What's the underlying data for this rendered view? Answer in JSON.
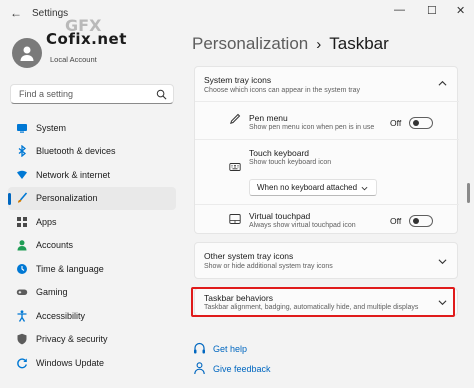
{
  "app": {
    "title": "Settings",
    "back_glyph": "←",
    "min_glyph": "—",
    "max_glyph": "☐",
    "close_glyph": "✕"
  },
  "profile": {
    "brand": "Cofix.net",
    "brand_watermark": "GFX",
    "account_type": "Local Account"
  },
  "search": {
    "placeholder": "Find a setting"
  },
  "nav": {
    "items": [
      {
        "label": "System",
        "icon": "system-icon",
        "color": "#0078d4"
      },
      {
        "label": "Bluetooth & devices",
        "icon": "bluetooth-icon",
        "color": "#0078d4"
      },
      {
        "label": "Network & internet",
        "icon": "network-icon",
        "color": "#0078d4"
      },
      {
        "label": "Personalization",
        "icon": "brush-icon",
        "color": "#d07a00",
        "active": true
      },
      {
        "label": "Apps",
        "icon": "apps-icon",
        "color": "#4a4a4a"
      },
      {
        "label": "Accounts",
        "icon": "accounts-icon",
        "color": "#1f9d55"
      },
      {
        "label": "Time & language",
        "icon": "time-language-icon",
        "color": "#0078d4"
      },
      {
        "label": "Gaming",
        "icon": "gaming-icon",
        "color": "#5c5c5c"
      },
      {
        "label": "Accessibility",
        "icon": "accessibility-icon",
        "color": "#0078d4"
      },
      {
        "label": "Privacy & security",
        "icon": "shield-icon",
        "color": "#5c5c5c"
      },
      {
        "label": "Windows Update",
        "icon": "update-icon",
        "color": "#0078d4"
      }
    ]
  },
  "breadcrumb": {
    "parent": "Personalization",
    "separator": "›",
    "current": "Taskbar"
  },
  "tray": {
    "title": "System tray icons",
    "subtitle": "Choose which icons can appear in the system tray",
    "pen": {
      "title": "Pen menu",
      "subtitle": "Show pen menu icon when pen is in use",
      "state": "Off"
    },
    "keyboard": {
      "title": "Touch keyboard",
      "subtitle": "Show touch keyboard icon",
      "selected": "When no keyboard attached"
    },
    "touchpad": {
      "title": "Virtual touchpad",
      "subtitle": "Always show virtual touchpad icon",
      "state": "Off"
    }
  },
  "other_tray": {
    "title": "Other system tray icons",
    "subtitle": "Show or hide additional system tray icons"
  },
  "behaviors": {
    "title": "Taskbar behaviors",
    "subtitle": "Taskbar alignment, badging, automatically hide, and multiple displays"
  },
  "links": {
    "help": "Get help",
    "feedback": "Give feedback"
  },
  "colors": {
    "accent": "#0067c0",
    "highlight": "#e01b1b"
  }
}
